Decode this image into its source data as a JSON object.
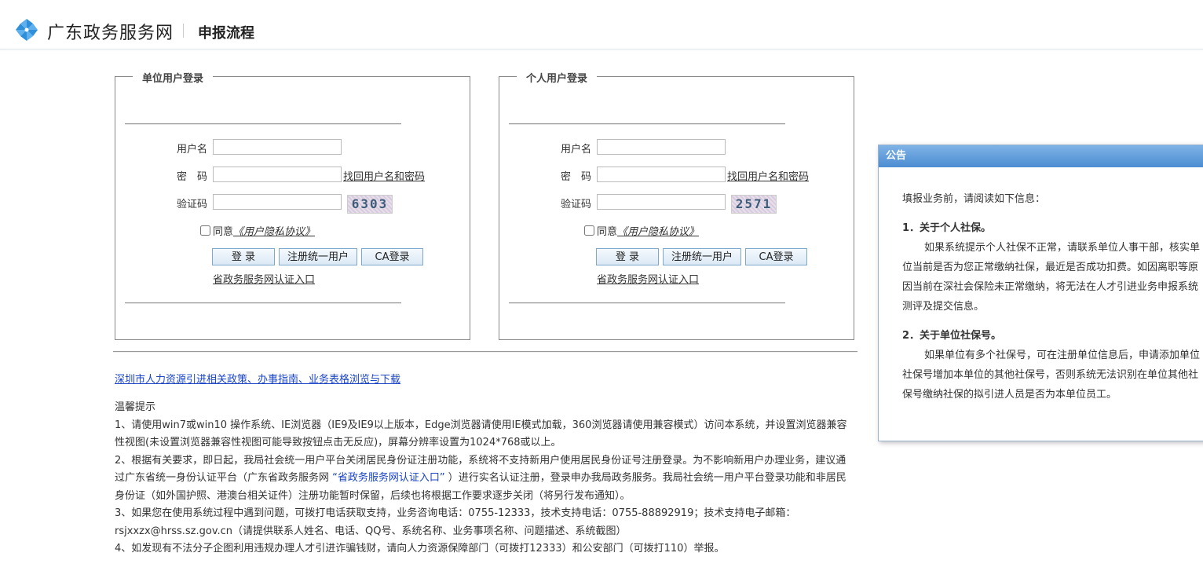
{
  "header": {
    "site_name": "广东政务服务网",
    "page_title": "申报流程",
    "logo_icon": "pinwheel-logo-icon"
  },
  "unit_login": {
    "legend": "单位用户登录",
    "username_label": "用户名",
    "password_label": "密　码",
    "forgot_link": "找回用户名和密码",
    "captcha_label": "验证码",
    "captcha_code": "6303",
    "agree_prefix": "同意",
    "agree_link": "《用户隐私协议》",
    "login_button": "登 录",
    "register_button": "注册统一用户",
    "ca_button": "CA登录",
    "province_link": "省政务服务网认证入口"
  },
  "personal_login": {
    "legend": "个人用户登录",
    "username_label": "用户名",
    "password_label": "密　码",
    "forgot_link": "找回用户名和密码",
    "captcha_label": "验证码",
    "captcha_code": "2571",
    "agree_prefix": "同意",
    "agree_link": "《用户隐私协议》",
    "login_button": "登 录",
    "register_button": "注册统一用户",
    "ca_button": "CA登录",
    "province_link": "省政务服务网认证入口"
  },
  "policy_link": "深圳市人力资源引进相关政策、办事指南、业务表格浏览与下载",
  "tips": {
    "title": "温馨提示",
    "item1": "1、请使用win7或win10 操作系统、IE浏览器（IE9及IE9以上版本，Edge浏览器请使用IE模式加载，360浏览器请使用兼容模式）访问本系统，并设置浏览器兼容性视图(未设置浏览器兼容性视图可能导致按钮点击无反应)，屏幕分辨率设置为1024*768或以上。",
    "item2_a": "2、根据有关要求，即日起，我局社会统一用户平台关闭居民身份证注册功能，系统将不支持新用户使用居民身份证号注册登录。为不影响新用户办理业务，建议通过广东省统一身份认证平台（广东省政务服务网 ",
    "item2_link": "“省政务服务网认证入口”",
    "item2_b": " ）进行实名认证注册，登录申办我局政务服务。我局社会统一用户平台登录功能和非居民身份证（如外国护照、港澳台相关证件）注册功能暂时保留，后续也将根据工作要求逐步关闭（将另行发布通知）。",
    "item3": "3、如果您在使用系统过程中遇到问题，可拨打电话获取支持，业务咨询电话：0755-12333，技术支持电话：0755-88892919；技术支持电子邮箱：rsjxxzx@hrss.sz.gov.cn（请提供联系人姓名、电话、QQ号、系统名称、业务事项名称、问题描述、系统截图）",
    "item4": "4、如发现有不法分子企图利用违规办理人才引进诈骗钱财，请向人力资源保障部门（可拨打12333）和公安部门（可拨打110）举报。"
  },
  "notice": {
    "title": "公告",
    "intro": "填报业务前，请阅读如下信息：",
    "sec1_title": "1．关于个人社保。",
    "sec1_text": "如果系统提示个人社保不正常，请联系单位人事干部，核实单位当前是否为您正常缴纳社保，最近是否成功扣费。如因离职等原因当前在深社会保险未正常缴纳，将无法在人才引进业务申报系统测评及提交信息。",
    "sec2_title": "2．关于单位社保号。",
    "sec2_text": "如果单位有多个社保号，可在注册单位信息后，申请添加单位社保号增加本单位的其他社保号，否则系统无法识别在单位其他社保号缴纳社保的拟引进人员是否为本单位员工。"
  }
}
